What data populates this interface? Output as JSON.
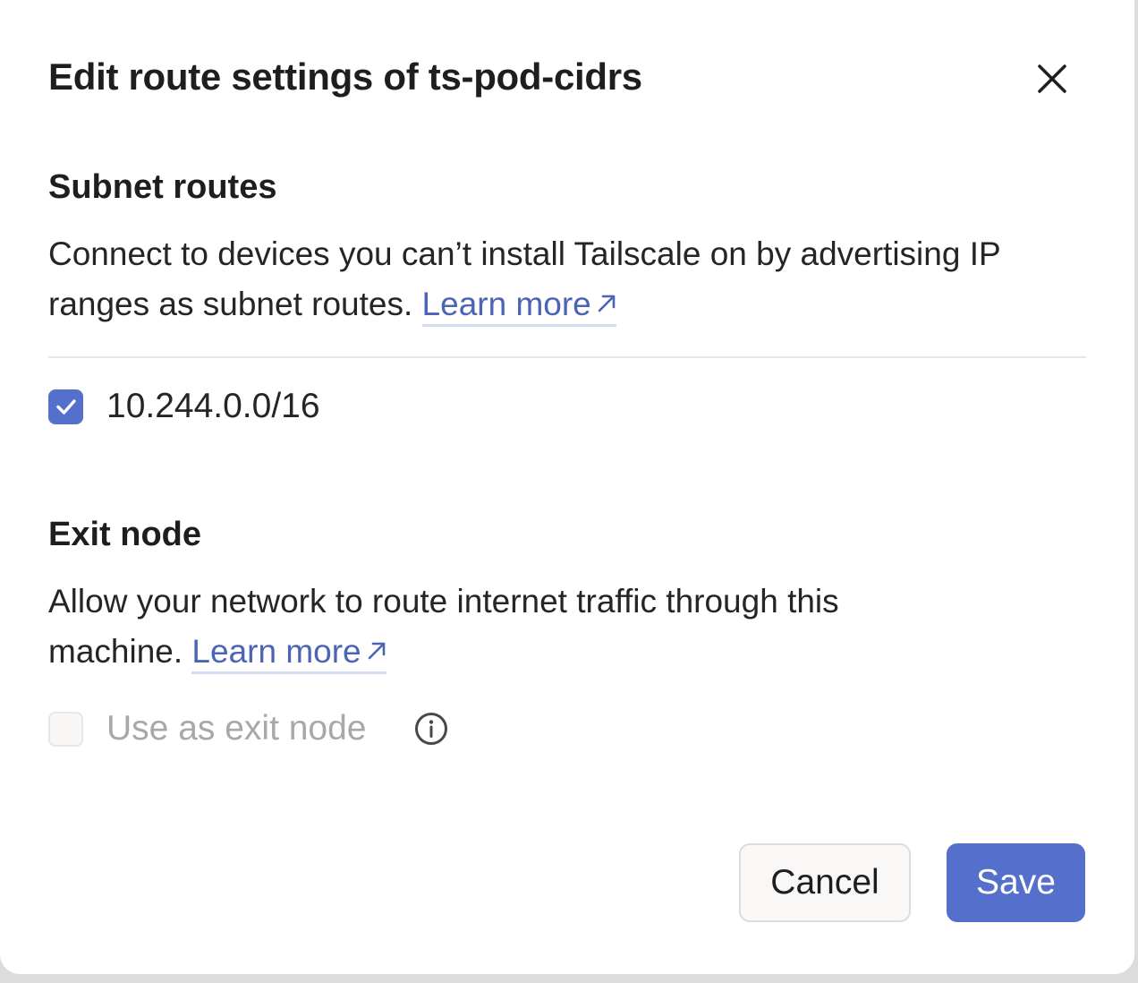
{
  "dialog": {
    "title": "Edit route settings of ts-pod-cidrs",
    "close_icon": "close-icon"
  },
  "subnet_routes": {
    "heading": "Subnet routes",
    "description": "Connect to devices you can’t install Tailscale on by advertising IP ranges as subnet routes.",
    "learn_more": "Learn more",
    "routes": [
      {
        "cidr": "10.244.0.0/16",
        "checked": true
      }
    ]
  },
  "exit_node": {
    "heading": "Exit node",
    "description": "Allow your network to route internet traffic through this machine.",
    "learn_more": "Learn more",
    "option_label": "Use as exit node",
    "checked": false,
    "disabled": true,
    "info_icon": "info-icon"
  },
  "actions": {
    "cancel_label": "Cancel",
    "save_label": "Save"
  },
  "colors": {
    "accent": "#5470cc",
    "link": "#4b64b3",
    "muted_text": "#aaa7a4"
  }
}
